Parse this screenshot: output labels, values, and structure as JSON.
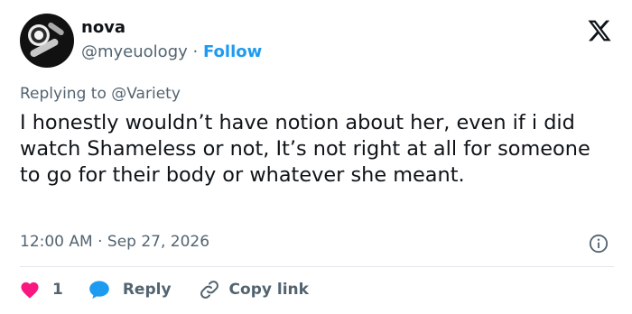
{
  "author": {
    "name": "nova",
    "handle": "@myeuology",
    "separator": "·",
    "follow_label": "Follow"
  },
  "tweet": {
    "replying_prefix": "Replying to",
    "replying_to": "@Variety",
    "text": "I honestly wouldn’t have notion about her, even if i did watch Shameless or not, It’s not right at all for someone to go for their body or whatever she meant.",
    "timestamp": "12:00 AM · Sep 27, 2026"
  },
  "actions": {
    "like_count": "1",
    "reply_label": "Reply",
    "copy_label": "Copy link"
  },
  "icons": {
    "brand": "x-logo-icon",
    "info": "info-icon",
    "like": "heart-icon",
    "reply": "speech-bubble-icon",
    "copy": "link-icon"
  },
  "colors": {
    "accent": "#1d9bf0",
    "heart": "#f91880",
    "text": "#0f1419",
    "muted": "#536471"
  }
}
